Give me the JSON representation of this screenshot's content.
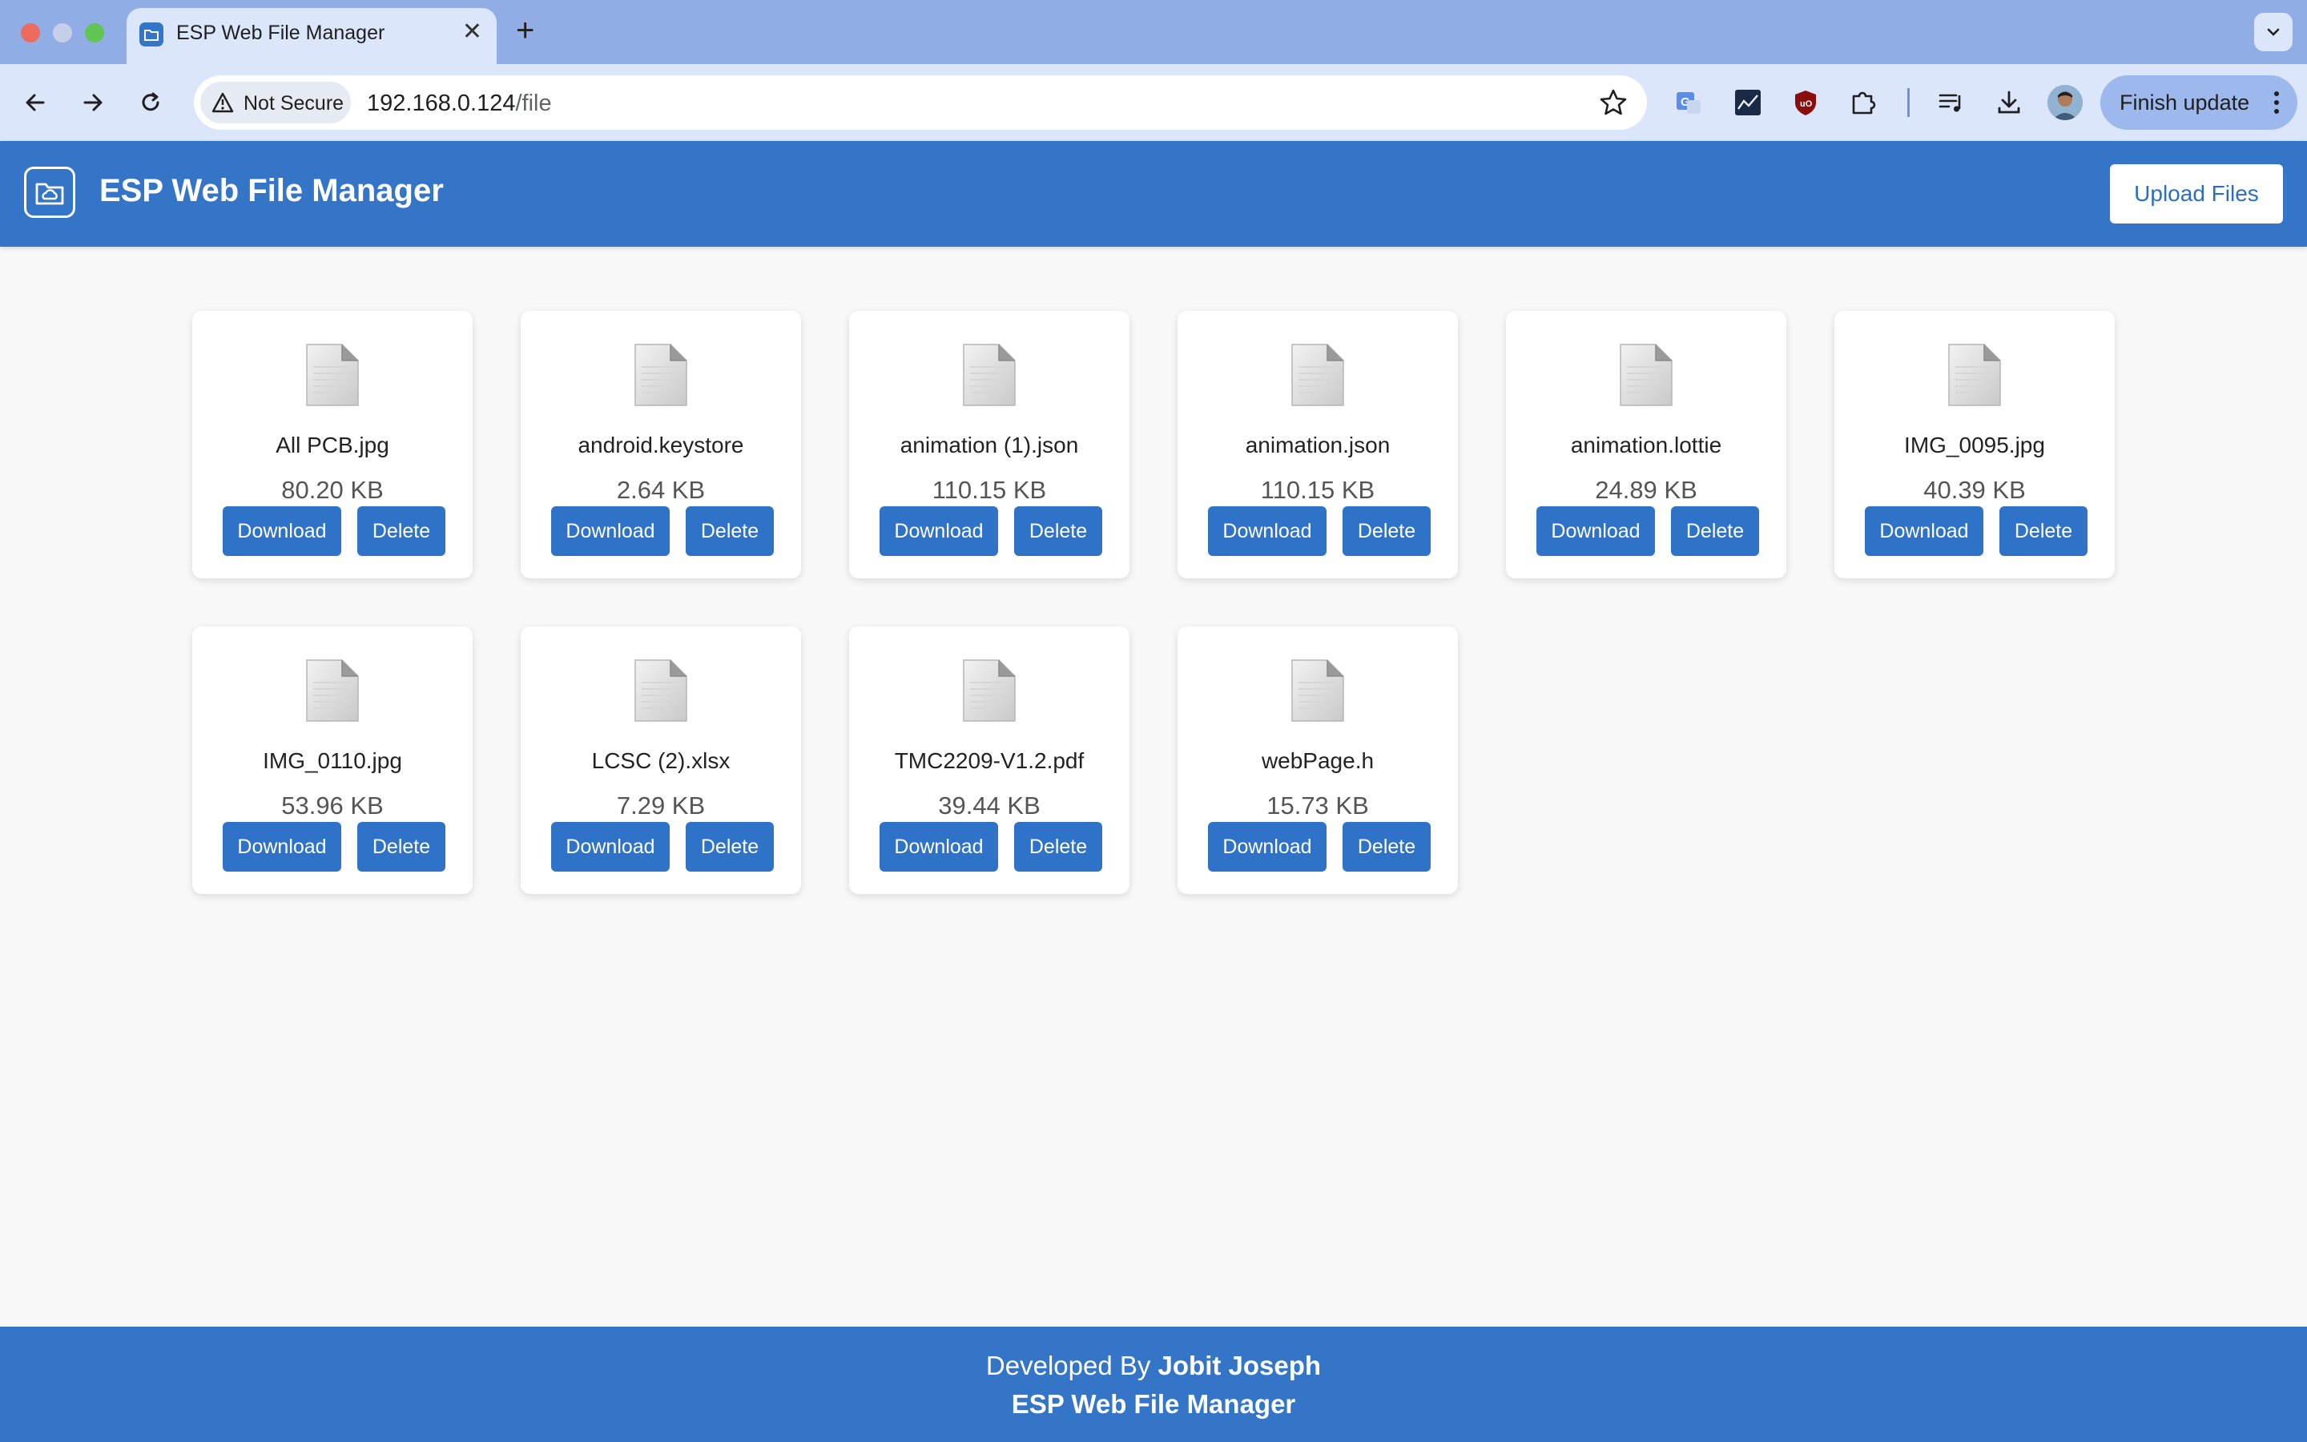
{
  "browser": {
    "tab_title": "ESP Web File Manager",
    "tab_favicon": "folder-cloud-icon",
    "new_tab_label": "+",
    "security_label": "Not Secure",
    "url_host": "192.168.0.124",
    "url_path": "/file",
    "finish_update_label": "Finish update",
    "extensions": [
      "translate-icon",
      "chart-extension-icon",
      "ublock-icon",
      "puzzle-icon",
      "media-queue-icon",
      "download-icon"
    ]
  },
  "app": {
    "title": "ESP Web File Manager",
    "upload_label": "Upload Files",
    "accent_color": "#3475c7"
  },
  "files": [
    {
      "name": "All PCB.jpg",
      "size": "80.20 KB"
    },
    {
      "name": "android.keystore",
      "size": "2.64 KB"
    },
    {
      "name": "animation (1).json",
      "size": "110.15 KB"
    },
    {
      "name": "animation.json",
      "size": "110.15 KB"
    },
    {
      "name": "animation.lottie",
      "size": "24.89 KB"
    },
    {
      "name": "IMG_0095.jpg",
      "size": "40.39 KB"
    },
    {
      "name": "IMG_0110.jpg",
      "size": "53.96 KB"
    },
    {
      "name": "LCSC (2).xlsx",
      "size": "7.29 KB"
    },
    {
      "name": "TMC2209-V1.2.pdf",
      "size": "39.44 KB"
    },
    {
      "name": "webPage.h",
      "size": "15.73 KB"
    }
  ],
  "file_actions": {
    "download_label": "Download",
    "delete_label": "Delete"
  },
  "footer": {
    "developed_by_prefix": "Developed By",
    "developer_name": "Jobit Joseph",
    "app_name": "ESP Web File Manager"
  }
}
